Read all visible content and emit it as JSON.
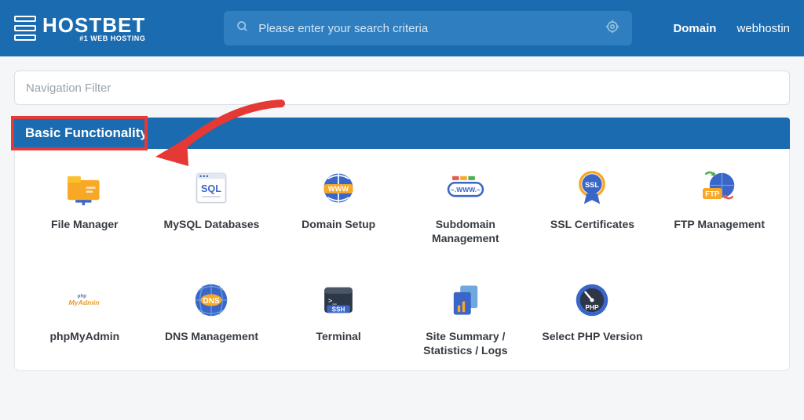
{
  "brand": {
    "name": "HOSTBET",
    "tagline": "#1 WEB HOSTING"
  },
  "search": {
    "placeholder": "Please enter your search criteria"
  },
  "nav": {
    "domain": "Domain",
    "account": "webhostin"
  },
  "filter": {
    "placeholder": "Navigation Filter"
  },
  "section": {
    "title": "Basic Functionality"
  },
  "items": [
    {
      "label": "File Manager"
    },
    {
      "label": "MySQL Databases"
    },
    {
      "label": "Domain Setup"
    },
    {
      "label": "Subdomain Management"
    },
    {
      "label": "SSL Certificates"
    },
    {
      "label": "FTP Management"
    },
    {
      "label": "phpMyAdmin"
    },
    {
      "label": "DNS Management"
    },
    {
      "label": "Terminal"
    },
    {
      "label": "Site Summary / Statistics / Logs"
    },
    {
      "label": "Select PHP Version"
    }
  ]
}
